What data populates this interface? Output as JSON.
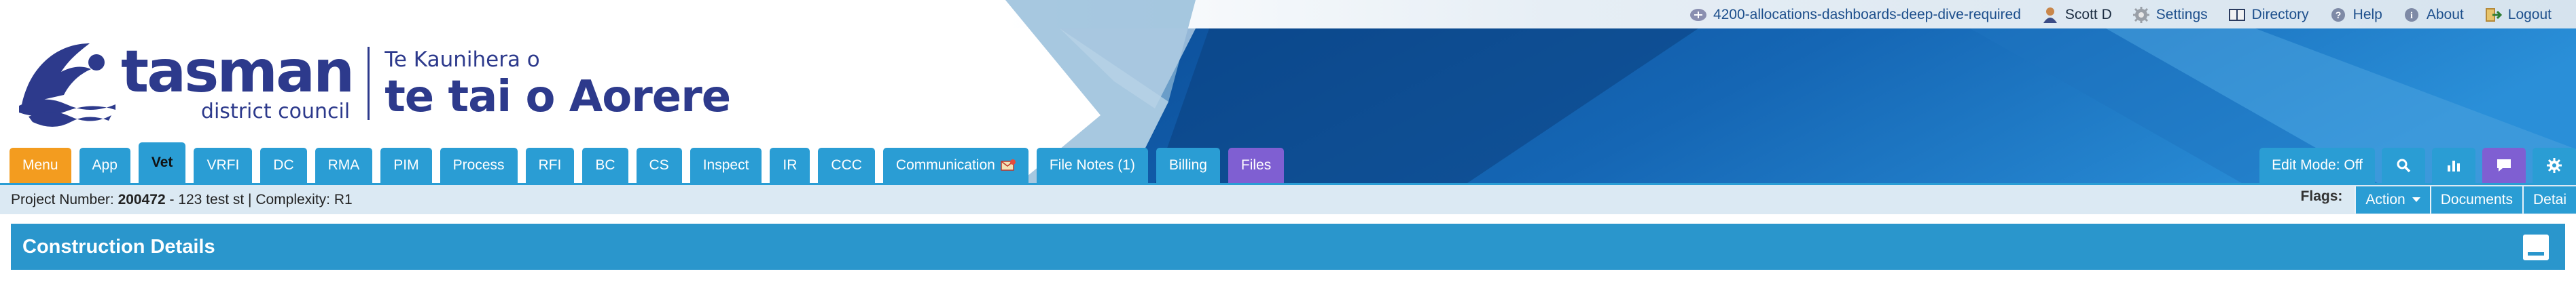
{
  "topbar": {
    "branch": "4200-allocations-dashboards-deep-dive-required",
    "user": "Scott D",
    "settings": "Settings",
    "directory": "Directory",
    "help": "Help",
    "about": "About",
    "logout": "Logout"
  },
  "logo": {
    "name": "tasman",
    "subtitle": "district council",
    "maori_small": "Te Kaunihera o",
    "maori_big": "te tai o Aorere"
  },
  "tabs": [
    {
      "label": "Menu"
    },
    {
      "label": "App"
    },
    {
      "label": "Vet"
    },
    {
      "label": "VRFI"
    },
    {
      "label": "DC"
    },
    {
      "label": "RMA"
    },
    {
      "label": "PIM"
    },
    {
      "label": "Process"
    },
    {
      "label": "RFI"
    },
    {
      "label": "BC"
    },
    {
      "label": "CS"
    },
    {
      "label": "Inspect"
    },
    {
      "label": "IR"
    },
    {
      "label": "CCC"
    },
    {
      "label": "Communication"
    },
    {
      "label": "File Notes (1)"
    },
    {
      "label": "Billing"
    },
    {
      "label": "Files"
    }
  ],
  "controls": {
    "edit_mode": "Edit Mode: Off"
  },
  "project": {
    "label": "Project Number:",
    "number": "200472",
    "rest": " - 123 test st | Complexity: R1"
  },
  "flags": {
    "label": "Flags:",
    "action": "Action",
    "documents": "Documents",
    "details": "Detai"
  },
  "section": {
    "title": "Construction Details"
  },
  "colors": {
    "tab_blue": "#2a9dd4",
    "menu_orange": "#f39c1f",
    "files_purple": "#7f5fd2",
    "brand_navy": "#2d3a8c"
  }
}
